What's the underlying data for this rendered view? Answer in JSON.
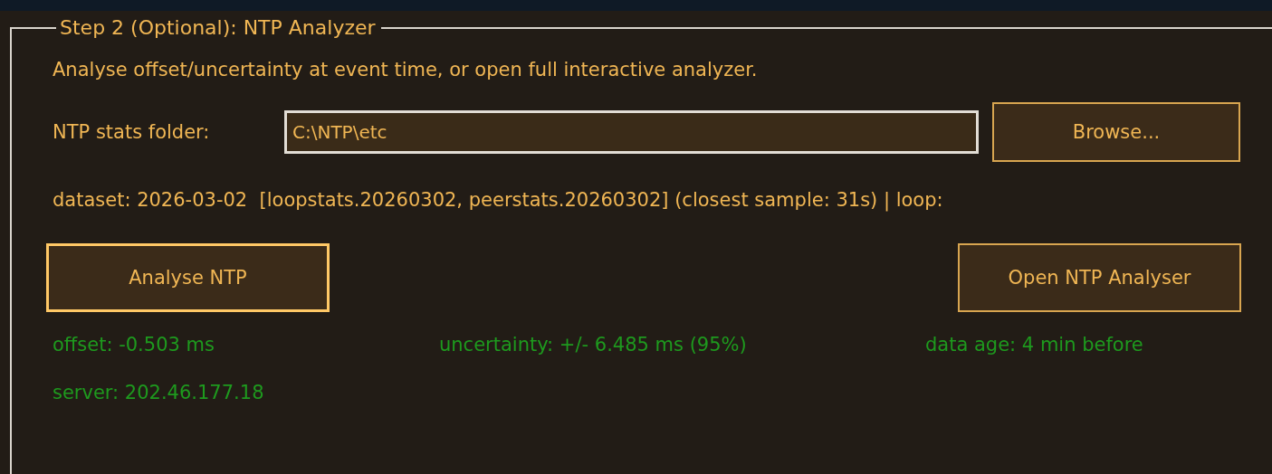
{
  "group": {
    "title": "Step 2 (Optional): NTP Analyzer"
  },
  "description": "Analyse offset/uncertainty at event time, or open full interactive analyzer.",
  "folder": {
    "label": "NTP stats folder:",
    "value": "C:\\NTP\\etc",
    "browse": {
      "label": "Browse...",
      "focused": false
    }
  },
  "dataset": "dataset: 2026-03-02  [loopstats.20260302, peerstats.20260302] (closest sample: 31s) | loop:",
  "buttons": [
    {
      "label": "Analyse NTP",
      "focused": true
    },
    {
      "label": "Open NTP Analyser",
      "focused": false
    }
  ],
  "results": [
    "offset: -0.503 ms",
    "uncertainty: +/- 6.485 ms (95%)",
    "data age: 4 min before",
    "server: 202.46.177.18"
  ]
}
